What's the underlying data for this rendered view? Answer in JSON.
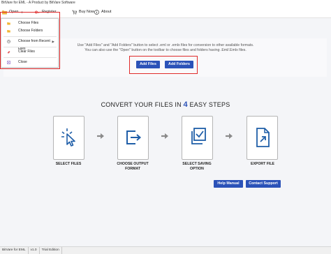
{
  "window": {
    "title": "BitVare for EML - A Product by BitVare Software"
  },
  "toolbar": {
    "open_label": "Open",
    "register_label": "Register",
    "buy_now_label": "Buy Now",
    "about_label": "About"
  },
  "open_menu": {
    "items": [
      "Choose Files",
      "Choose Folders",
      "Choose from Recent Files",
      "Clear Files",
      "Close"
    ]
  },
  "main": {
    "instruction_line1": "Use \"Add Files\" and \"Add Folders\" button to select .eml or .emlx files for conversion to other available formats.",
    "instruction_line2": "You can also use the \"Open\" button on the toolbar to choose files and folders having .Eml/.Emlx files.",
    "add_files_label": "Add Files",
    "add_folders_label": "Add Folders",
    "heading_prefix": "CONVERT YOUR FILES IN",
    "heading_number": "4",
    "heading_suffix": "EASY STEPS",
    "steps": [
      {
        "label_line1": "SELECT FILES",
        "label_line2": ""
      },
      {
        "label_line1": "CHOOSE OUTPUT",
        "label_line2": "FORMAT"
      },
      {
        "label_line1": "SELECT SAVING",
        "label_line2": "OPTION"
      },
      {
        "label_line1": "EXPORT FILE",
        "label_line2": ""
      }
    ],
    "help_manual_label": "Help Manual",
    "contact_support_label": "Contact Support"
  },
  "statusbar": {
    "app_name": "BitVare for EML",
    "version": "v1.0",
    "edition": "Trial Edition"
  },
  "colors": {
    "accent": "#2b52b8",
    "highlight": "#e02a2a",
    "icon_blue": "#1f5ea8"
  }
}
